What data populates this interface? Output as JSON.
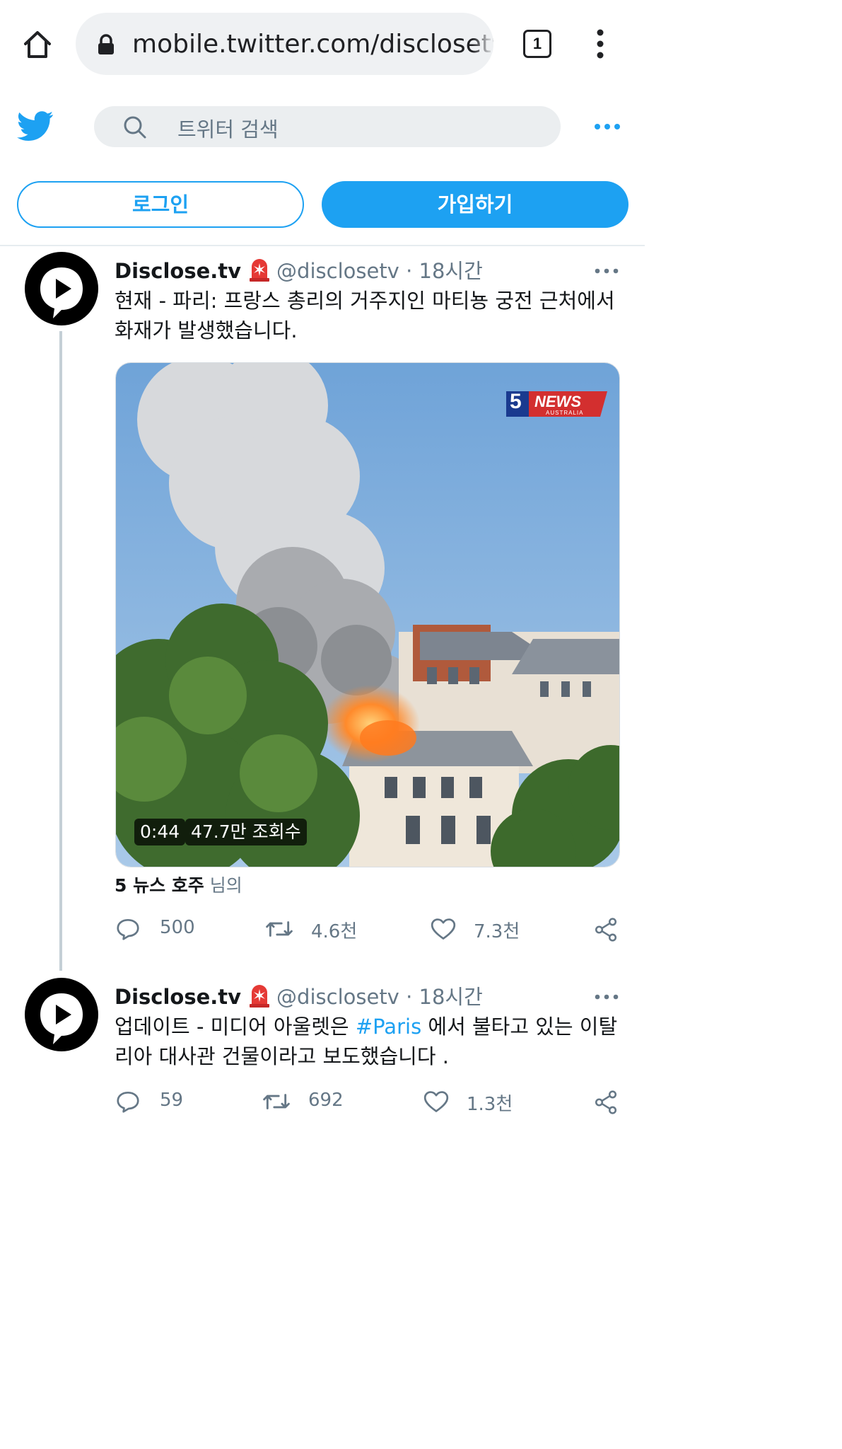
{
  "browser": {
    "url": "mobile.twitter.com/disclosetv",
    "tab_count": "1",
    "icons": [
      "home-icon",
      "lock-icon",
      "tabs-icon",
      "more-vertical-icon"
    ]
  },
  "header": {
    "search_placeholder": "트위터 검색",
    "login_label": "로그인",
    "signup_label": "가입하기",
    "brand_color": "#1da1f2"
  },
  "tweets": [
    {
      "name": "Disclose.tv",
      "handle": "@disclosetv",
      "time": "· 18시간",
      "text": "현재 - 파리: 프랑스 총리의 거주지인 마티뇽 궁전 근처에서 화재가 발생했습니다.",
      "media": {
        "duration": "0:44",
        "views": "47.7만 조회수",
        "logo_number": "5",
        "logo_text": "NEWS",
        "logo_sub": "AUSTRALIA"
      },
      "source_name": "5 뉴스 호주",
      "source_suffix": "님의",
      "replies": "500",
      "retweets": "4.6천",
      "likes": "7.3천"
    },
    {
      "name": "Disclose.tv",
      "handle": "@disclosetv",
      "time": "· 18시간",
      "text_before": "업데이트 - 미디어 아울렛은 ",
      "hashtag": "#Paris",
      "text_after": " 에서 불타고 있는 이탈리아 대사관 건물이라고 보도했습니다 .",
      "replies": "59",
      "retweets": "692",
      "likes": "1.3천"
    }
  ]
}
